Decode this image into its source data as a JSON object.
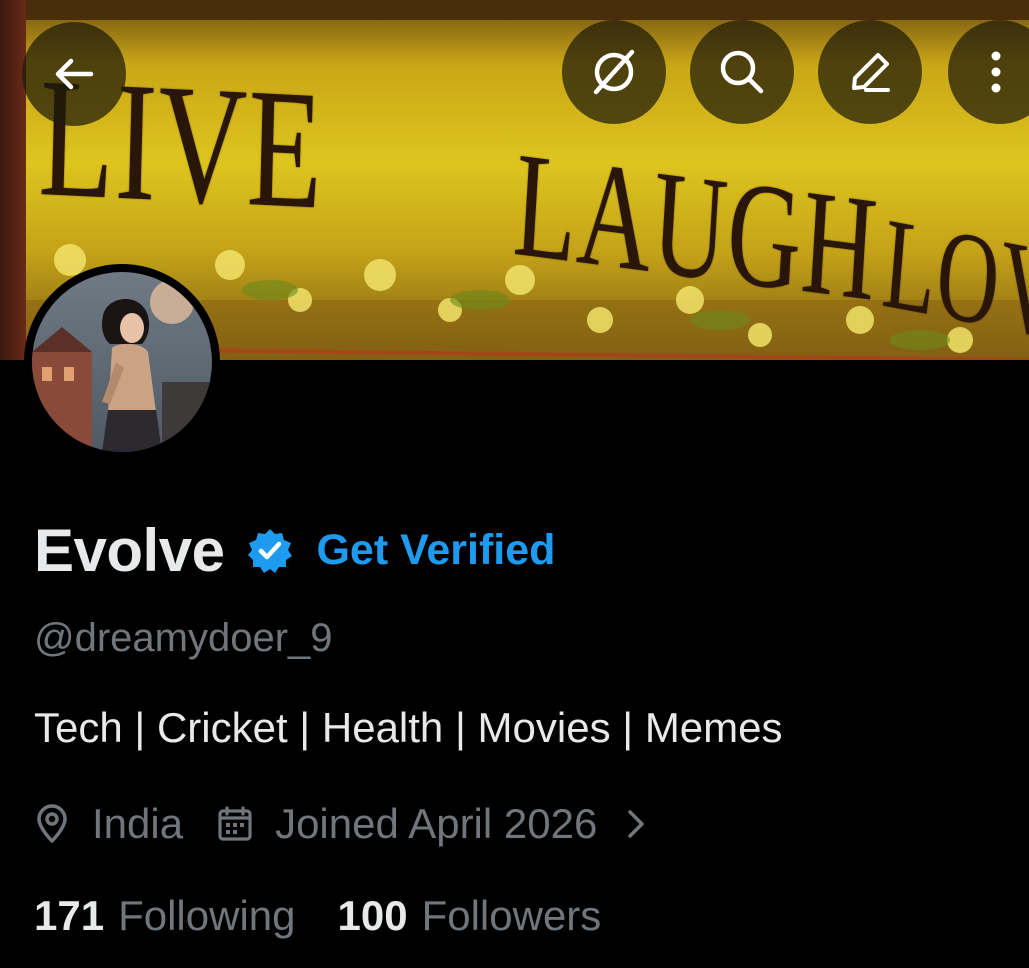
{
  "banner": {
    "words": [
      "LIVE",
      "LAUGH",
      "LOVE"
    ]
  },
  "toolbar": {
    "back_icon": "arrow-left-icon",
    "grok_icon": "grok-icon",
    "search_icon": "search-icon",
    "edit_icon": "pencil-icon",
    "more_icon": "more-vertical-icon"
  },
  "profile": {
    "display_name": "Evolve",
    "get_verified_label": "Get Verified",
    "handle": "@dreamydoer_9",
    "bio": "Tech | Cricket | Health | Movies | Memes",
    "location": "India",
    "joined": "Joined April 2026",
    "following_count": "171",
    "following_label": "Following",
    "followers_count": "100",
    "followers_label": "Followers"
  },
  "colors": {
    "accent": "#1d9bf0",
    "text_primary": "#e7e9ea",
    "text_secondary": "#71767b",
    "background": "#000000"
  }
}
